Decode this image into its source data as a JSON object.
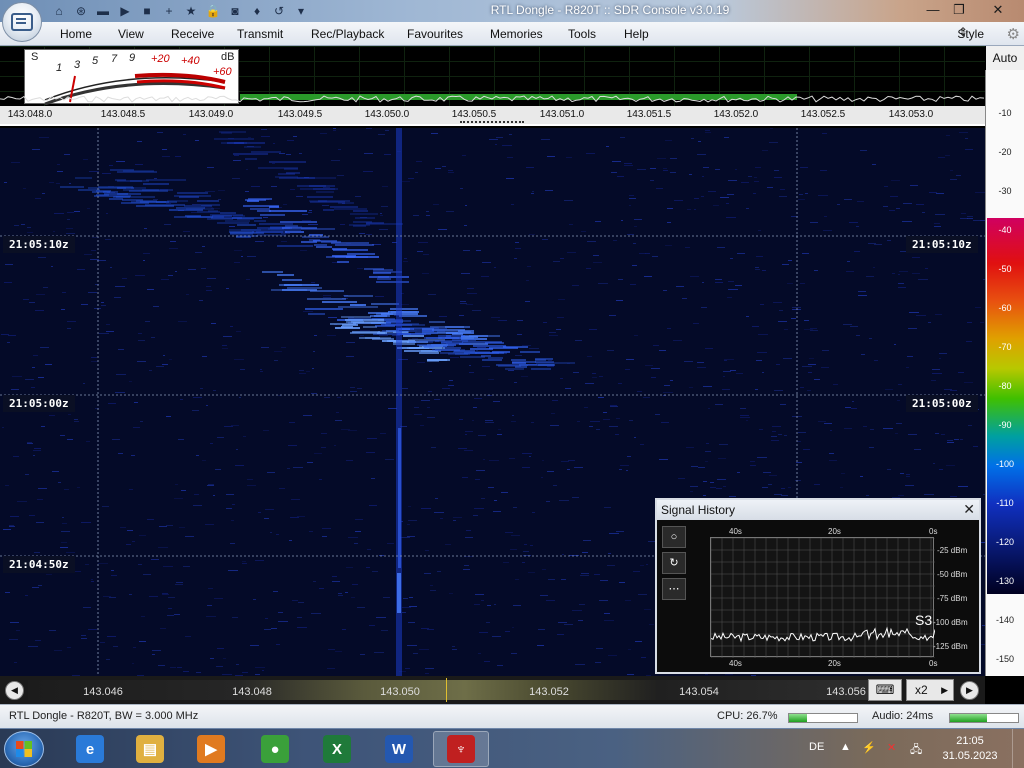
{
  "window": {
    "title": "RTL Dongle - R820T :: SDR Console v3.0.19",
    "minimize_icon": "—",
    "restore_icon": "❐",
    "close_icon": "✕"
  },
  "quick_access": [
    {
      "icon": "home-icon",
      "glyph": "⌂"
    },
    {
      "icon": "lifebuoy-icon",
      "glyph": "⊛"
    },
    {
      "icon": "folder-icon",
      "glyph": "▬"
    },
    {
      "icon": "play-icon",
      "glyph": "▶"
    },
    {
      "icon": "stop-icon",
      "glyph": "■"
    },
    {
      "icon": "plus-icon",
      "glyph": "+"
    },
    {
      "icon": "star-icon",
      "glyph": "★"
    },
    {
      "icon": "lock-icon",
      "glyph": "🔒"
    },
    {
      "icon": "camera-icon",
      "glyph": "◙"
    },
    {
      "icon": "drop-icon",
      "glyph": "♦"
    },
    {
      "icon": "undo-icon",
      "glyph": "↺"
    },
    {
      "icon": "dropdown-icon",
      "glyph": "▾"
    }
  ],
  "ribbon": {
    "tabs": [
      "Home",
      "View",
      "Receive",
      "Transmit",
      "Rec/Playback",
      "Favourites",
      "Memories",
      "Tools",
      "Help"
    ],
    "style_label": "Style"
  },
  "smeter": {
    "s_label": "S",
    "db_label": "dB",
    "s_scale": [
      "1",
      "3",
      "5",
      "7",
      "9"
    ],
    "db_scale": [
      "+20",
      "+40",
      "+60"
    ]
  },
  "spectrum": {
    "freq_ticks": [
      "143.048.0",
      "143.048.5",
      "143.049.0",
      "143.049.5",
      "143.050.0",
      "143.050.5",
      "143.051.0",
      "143.051.5",
      "143.052.0",
      "143.052.5",
      "143.053.0"
    ]
  },
  "db_scale": {
    "auto_label": "Auto",
    "labels": [
      "-10",
      "-20",
      "-30",
      "-40",
      "-50",
      "-60",
      "-70",
      "-80",
      "-90",
      "-100",
      "-110",
      "-120",
      "-130",
      "-140",
      "-150"
    ]
  },
  "waterfall": {
    "timestamps": [
      "21:05:10z",
      "21:05:00z",
      "21:04:50z"
    ]
  },
  "signal_history": {
    "title": "Signal History",
    "close": "✕",
    "top_labels": [
      "40s",
      "20s",
      "0s"
    ],
    "bottom_labels": [
      "40s",
      "20s",
      "0s"
    ],
    "dbm_labels": [
      "-25 dBm",
      "-50 dBm",
      "-75 dBm",
      "-100 dBm",
      "-125 dBm"
    ],
    "s_reading": "S3",
    "buttons": [
      "○",
      "↻",
      "⋯"
    ]
  },
  "bottom_scale": {
    "ticks": [
      "143.046",
      "143.048",
      "143.050",
      "143.052",
      "143.054",
      "143.056"
    ],
    "rewind_icon": "◀",
    "forward_icon": "▶",
    "keyboard_icon": "⌨",
    "zoom_label": "x2",
    "zoom_arrow": "▶"
  },
  "status": {
    "device": "RTL Dongle - R820T, BW = 3.000 MHz",
    "cpu": "CPU: 26.7%",
    "cpu_value": 0.267,
    "audio": "Audio: 24ms",
    "audio_value": 0.55
  },
  "taskbar": {
    "language": "DE",
    "time": "21:05",
    "date": "31.05.2023",
    "apps": [
      {
        "name": "internet-explorer",
        "glyph": "e",
        "color": "#2a7ad8"
      },
      {
        "name": "file-explorer",
        "glyph": "▤",
        "color": "#e0b040"
      },
      {
        "name": "media-player",
        "glyph": "▶",
        "color": "#e07a20"
      },
      {
        "name": "chrome",
        "glyph": "●",
        "color": "#3aa03a"
      },
      {
        "name": "excel",
        "glyph": "X",
        "color": "#1f7a3a"
      },
      {
        "name": "word",
        "glyph": "W",
        "color": "#2458b0"
      },
      {
        "name": "sdr-console",
        "glyph": "♆",
        "color": "#c02020"
      }
    ],
    "tray": [
      "▲",
      "⚡",
      "✕",
      "🖧"
    ]
  },
  "colors": {
    "waterfall_bg": "#040a28",
    "signal_blue": "#1a5cff",
    "green_bar": "#2a9a2a",
    "marker_yellow": "#e0c030"
  }
}
